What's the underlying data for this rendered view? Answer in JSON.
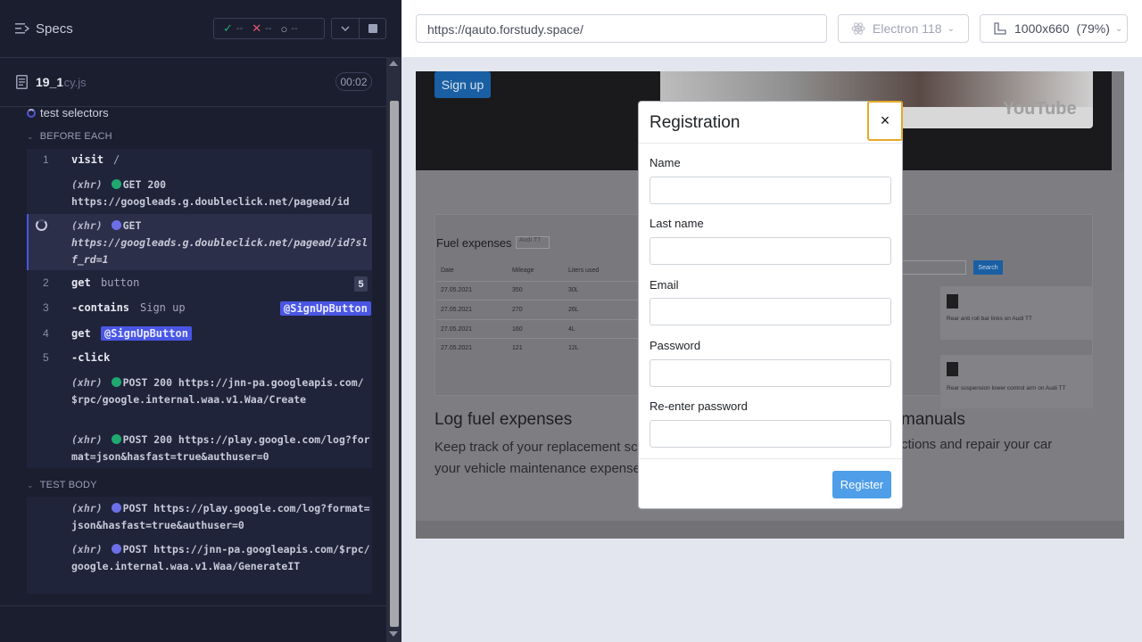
{
  "reporter": {
    "header": {
      "title": "Specs"
    },
    "stats": {
      "passed": "--",
      "failed": "--",
      "pending": "--"
    },
    "file": {
      "name": "19_1",
      "ext": ".cy.js",
      "duration": "00:02"
    },
    "test_title": "test selectors",
    "before_each_label": "BEFORE EACH",
    "test_body_label": "TEST BODY",
    "commands": {
      "c1_num": "1",
      "c1_name": "visit",
      "c1_arg": "/",
      "x1_tag": "(xhr)",
      "x1_method": "GET 200",
      "x1_url": "https://googleads.g.doubleclick.net/pagead/id",
      "x2_tag": "(xhr)",
      "x2_method": "GET",
      "x2_url": "https://googleads.g.doubleclick.net/pagead/id?slf_rd=1",
      "c2_num": "2",
      "c2_name": "get",
      "c2_arg": "button",
      "c2_count": "5",
      "c3_num": "3",
      "c3_name": "-contains",
      "c3_arg": "Sign up",
      "c3_alias": "@SignUpButton",
      "c4_num": "4",
      "c4_name": "get",
      "c4_alias": "@SignUpButton",
      "c5_num": "5",
      "c5_name": "-click",
      "x3_tag": "(xhr)",
      "x3_text": "POST 200 https://jnn-pa.googleapis.com/$rpc/google.internal.waa.v1.Waa/Create",
      "x4_tag": "(xhr)",
      "x4_text": "POST 200 https://play.google.com/log?format=json&hasfast=true&authuser=0",
      "x5_tag": "(xhr)",
      "x5_text": "POST https://play.google.com/log?format=json&hasfast=true&authuser=0",
      "x6_tag": "(xhr)",
      "x6_text": "POST https://jnn-pa.googleapis.com/$rpc/google.internal.waa.v1.Waa/GenerateIT"
    }
  },
  "browser": {
    "url": "https://qauto.forstudy.space/",
    "browser_name": "Electron 118",
    "viewport": "1000x660",
    "zoom": "(79%)"
  },
  "aut": {
    "signup_label": "Sign up",
    "youtube_label": "YouTube",
    "fuel_title": "Fuel expenses",
    "fuel_select": "Audi TT",
    "table_headers": [
      "Date",
      "Mileage",
      "Liters used"
    ],
    "table_rows": [
      [
        "27.05.2021",
        "350",
        "30L"
      ],
      [
        "27.05.2021",
        "270",
        "26L"
      ],
      [
        "27.05.2021",
        "160",
        "4L"
      ],
      [
        "27.05.2021",
        "121",
        "12L"
      ]
    ],
    "search_label": "Search",
    "card1_text": "Rear anti roll bar links on Audi TT",
    "card2_text": "Rear suspension lower control arm on Audi TT",
    "log_fuel_title": "Log fuel expenses",
    "log_fuel_desc": "Keep track of your replacement sch your vehicle maintenance expense",
    "manuals_title": "manuals",
    "manuals_desc": "ctions and repair your car"
  },
  "modal": {
    "title": "Registration",
    "close_glyph": "×",
    "fields": {
      "name_label": "Name",
      "last_name_label": "Last name",
      "email_label": "Email",
      "password_label": "Password",
      "repassword_label": "Re-enter password"
    },
    "register_label": "Register"
  },
  "colors": {
    "reporter_bg": "#1b1e2e",
    "pass": "#1fa971",
    "fail": "#e45770",
    "accent": "#4956e3",
    "register": "#4f9ee9",
    "focus": "#e5a92a"
  }
}
